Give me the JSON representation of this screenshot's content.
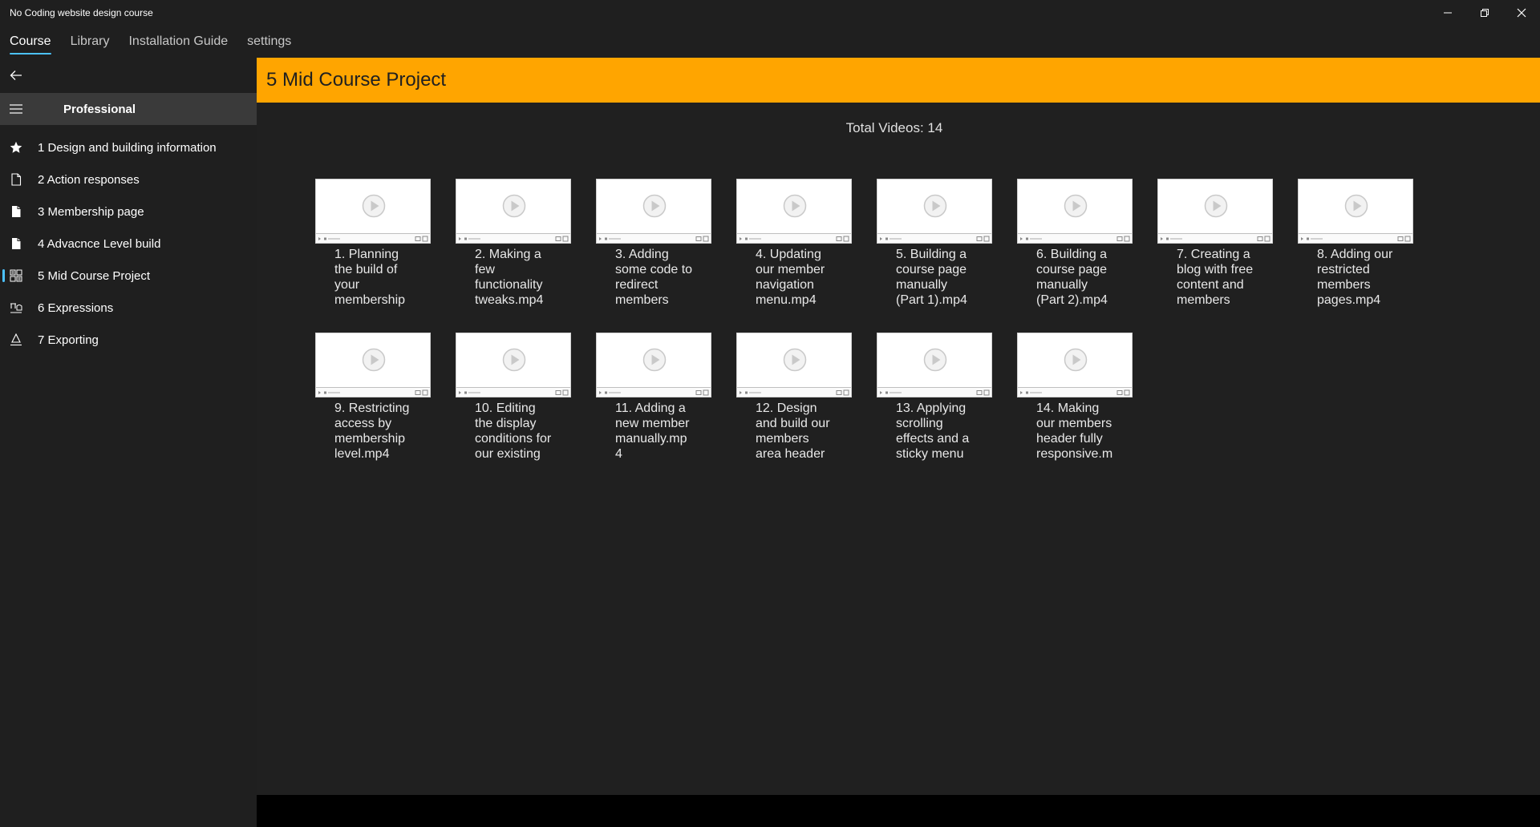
{
  "window": {
    "title": "No Coding website design course"
  },
  "nav": {
    "tabs": [
      {
        "label": "Course"
      },
      {
        "label": "Library"
      },
      {
        "label": "Installation Guide"
      },
      {
        "label": "settings"
      }
    ]
  },
  "sidebar": {
    "pane_title": "Professional",
    "items": [
      {
        "label": "1 Design and building information",
        "icon": "star-icon"
      },
      {
        "label": "2 Action responses",
        "icon": "document-outline-icon"
      },
      {
        "label": "3 Membership page",
        "icon": "document-filled-icon"
      },
      {
        "label": "4 Advacnce Level build",
        "icon": "document-filled-icon"
      },
      {
        "label": "5  Mid Course Project",
        "icon": "grid-icon"
      },
      {
        "label": "6  Expressions",
        "icon": "expressions-icon"
      },
      {
        "label": "7  Exporting",
        "icon": "export-icon"
      }
    ]
  },
  "main": {
    "header_title": "5  Mid Course Project",
    "total_videos": "Total Videos: 14",
    "videos": [
      {
        "caption": "1. Planning the build of your membership"
      },
      {
        "caption": "2. Making a few functionality tweaks.mp4"
      },
      {
        "caption": "3. Adding some code to redirect members"
      },
      {
        "caption": "4. Updating our member navigation menu.mp4"
      },
      {
        "caption": "5. Building a course page manually (Part 1).mp4"
      },
      {
        "caption": "6. Building a course page manually (Part 2).mp4"
      },
      {
        "caption": "7. Creating a blog with free content and members"
      },
      {
        "caption": "8. Adding our restricted members pages.mp4"
      },
      {
        "caption": "9. Restricting access by membership level.mp4"
      },
      {
        "caption": "10. Editing the display conditions for our existing"
      },
      {
        "caption": "11. Adding a new member manually.mp 4"
      },
      {
        "caption": "12. Design and build our members area header"
      },
      {
        "caption": "13. Applying scrolling effects and a sticky menu"
      },
      {
        "caption": "14. Making our members header fully responsive.m"
      }
    ]
  },
  "colors": {
    "accent": "#4cc2ff",
    "header_band": "#ffa500",
    "background": "#202020"
  }
}
